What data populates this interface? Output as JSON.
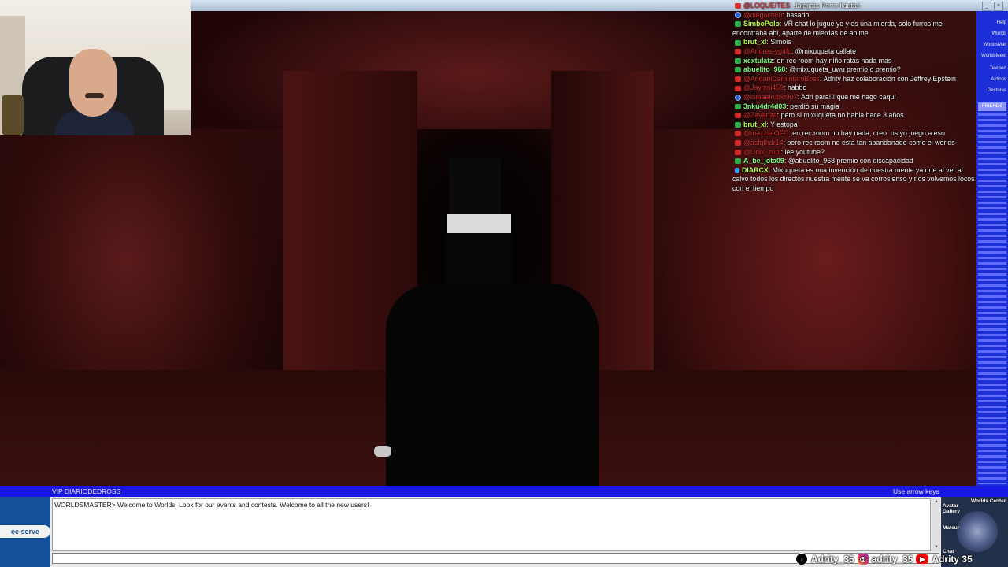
{
  "game": {
    "status_left": "VIP DIARIODEDROSS",
    "status_right": "Use arrow keys",
    "status_cap": "\"",
    "chat_log": [
      "WORLDSMASTER> Welcome to Worlds! Look for our events and contests. Welcome to all the new users!"
    ],
    "chat_input_value": "",
    "side_panel": [
      "Help",
      "Worlds",
      "WorldsMall",
      "WorldsMeet",
      "Teleport",
      "Actions",
      "Gestures",
      "FRIENDS"
    ],
    "friends_label": "FRIENDS",
    "nav_labels": {
      "worlds_center": "Worlds Center",
      "avatar_gallery": "Avatar Gallery",
      "mateur": "Mateur",
      "chat": "Chat"
    },
    "ad_label": "ee serve"
  },
  "stream_chat": [
    {
      "badge": "red",
      "user": "",
      "user_color": "red",
      "text": "Jajajjaja Perro flautas",
      "user_display": "@LOQUEITES"
    },
    {
      "badge": "blue",
      "user_display": "@diegocb60",
      "user_color": "red",
      "text": "basado"
    },
    {
      "badge": "green",
      "user_display": "SimboPolo",
      "user_color": "lime",
      "text": "VR chat lo jugue yo y es una mierda, solo furros me encontraba ahi, aparte de mierdas de anime"
    },
    {
      "badge": "green",
      "user_display": "brut_xl",
      "user_color": "lime",
      "text": "Simois"
    },
    {
      "badge": "red",
      "user_display": "@Andres-yg4fc",
      "user_color": "red",
      "text": "@mixuqueta callate"
    },
    {
      "badge": "green",
      "user_display": "xextulatz",
      "user_color": "green",
      "text": "en rec room hay niño ratas nada mas"
    },
    {
      "badge": "green",
      "user_display": "abuelito_968",
      "user_color": "green",
      "text": "@mixuqueta_uwu premio o premio?",
      "mention": "@mixuqueta_uwu"
    },
    {
      "badge": "red",
      "user_display": "@AndaniCarpinteroBoss",
      "user_color": "red",
      "text": "Adrity haz colaboración con Jeffrey Epstein"
    },
    {
      "badge": "red",
      "user_display": "@Jaymsi459",
      "user_color": "red",
      "text": "habbo"
    },
    {
      "badge": "blue",
      "user_display": "@ismaelrubio907",
      "user_color": "red",
      "text": "Adri para!!! que me hago caqui"
    },
    {
      "badge": "green",
      "user_display": "3nku4dr4d03",
      "user_color": "green",
      "text": "perdió su magia"
    },
    {
      "badge": "red",
      "user_display": "@Zavanza",
      "user_color": "red",
      "text": "pero si mixuqueta no habla hace 3 años"
    },
    {
      "badge": "green",
      "user_display": "brut_xl",
      "user_color": "lime",
      "text": "Y estopa"
    },
    {
      "badge": "red",
      "user_display": "@mazzieiOFC",
      "user_color": "red",
      "text": "en rec room no hay nada, creo, ns yo juego a eso"
    },
    {
      "badge": "red",
      "user_display": "@asfgfhdr14",
      "user_color": "red",
      "text": "pero rec room no esta tan abandonado como el worlds"
    },
    {
      "badge": "red",
      "user_display": "@Unix_zupl",
      "user_color": "red",
      "text": "lee youtube?"
    },
    {
      "badge": "green",
      "user_display": "A_be_jota09",
      "user_color": "green",
      "text": "@abuelito_968 premio con discapacidad",
      "mention": "@abuelito_968"
    },
    {
      "badge": "bolt",
      "user_display": "DIARCX",
      "user_color": "lime",
      "text": "Mixuqueta es una invención de nuestra mente ya que al ver al calvo todos los directos nuestra mente se va corrosienso y nos volvemos locos con el tiempo"
    }
  ],
  "socials": [
    {
      "icon": "tiktok-icon",
      "handle": "Adrity_35"
    },
    {
      "icon": "instagram-icon",
      "handle": "adrity_35"
    },
    {
      "icon": "youtube-icon",
      "handle": "Adrity 35"
    }
  ]
}
